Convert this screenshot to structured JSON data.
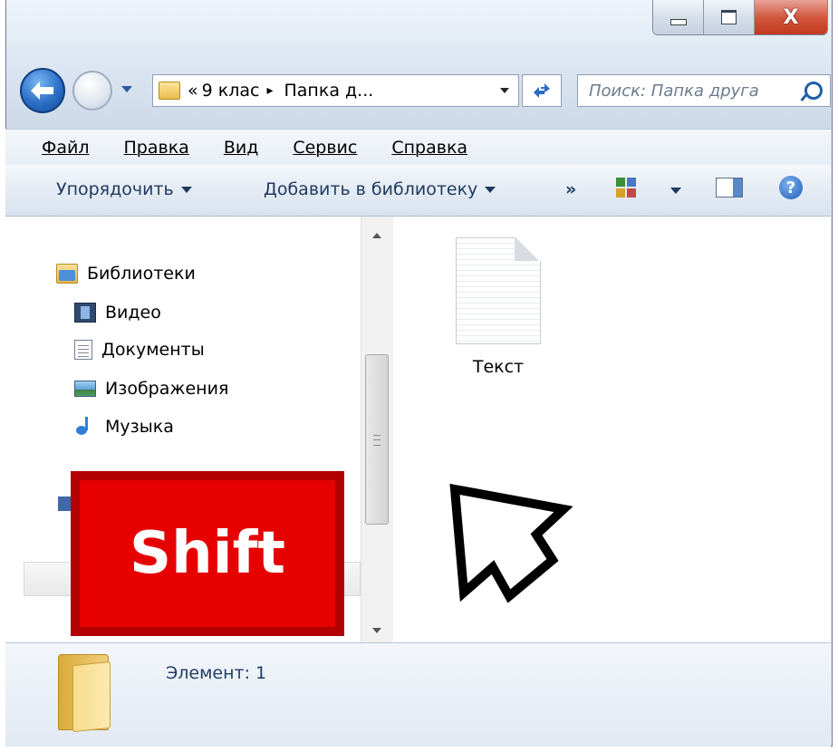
{
  "window": {
    "caption_buttons": {
      "minimize": "minimize",
      "maximize": "maximize",
      "close": "X"
    }
  },
  "address_bar": {
    "chevrons": "«",
    "segment1": "9 клас",
    "separator": "▸",
    "segment2": "Папка д...",
    "search_placeholder": "Поиск: Папка друга"
  },
  "menu": {
    "items": [
      "Файл",
      "Правка",
      "Вид",
      "Сервис",
      "Справка"
    ]
  },
  "toolbar": {
    "organize": "Упорядочить",
    "add_to_library": "Добавить в библиотеку",
    "more": "»",
    "help": "?"
  },
  "nav_pane": {
    "libraries": "Библиотеки",
    "items": [
      "Видео",
      "Документы",
      "Изображения",
      "Музыка"
    ]
  },
  "content": {
    "files": [
      {
        "name": "Текст",
        "icon": "text-file-icon"
      }
    ]
  },
  "status_bar": {
    "text": "Элемент: 1"
  },
  "overlay": {
    "key_label": "Shift",
    "key_color": "#e60000"
  }
}
